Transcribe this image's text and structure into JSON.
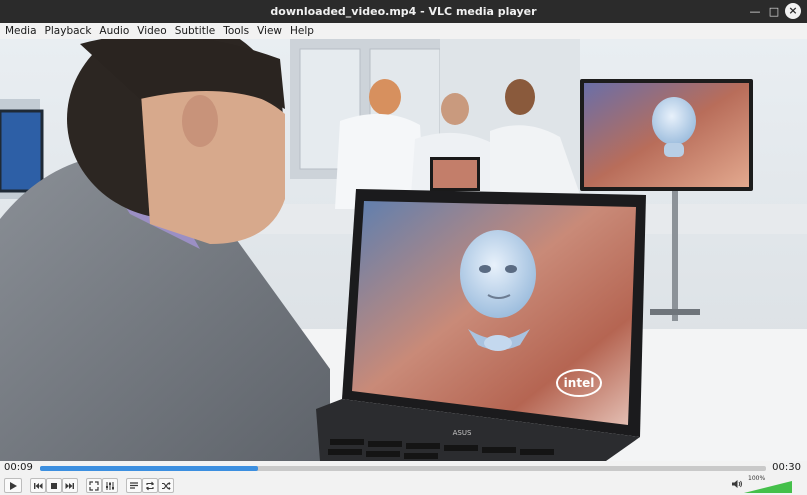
{
  "window": {
    "title": "downloaded_video.mp4 - VLC media player",
    "minimize_glyph": "—",
    "maximize_glyph": "□",
    "close_glyph": "×"
  },
  "menu": [
    "Media",
    "Playback",
    "Audio",
    "Video",
    "Subtitle",
    "Tools",
    "View",
    "Help"
  ],
  "video": {
    "laptop_brand": "ASUS",
    "screen_logo": "intel"
  },
  "playback": {
    "elapsed": "00:09",
    "total": "00:30",
    "progress_fraction": 0.3
  },
  "controls": {
    "icons": [
      "play-icon",
      "previous-icon",
      "stop-icon",
      "next-icon",
      "fullscreen-icon",
      "extended-settings-icon",
      "playlist-icon",
      "loop-icon",
      "shuffle-icon"
    ],
    "volume_label": "100%",
    "volume_fraction": 1.0
  },
  "colors": {
    "accent": "#3c8fe0",
    "titlebar": "#2b2b2b",
    "toolbar": "#f2f2f2",
    "volume_ramp": "#44c04a"
  }
}
